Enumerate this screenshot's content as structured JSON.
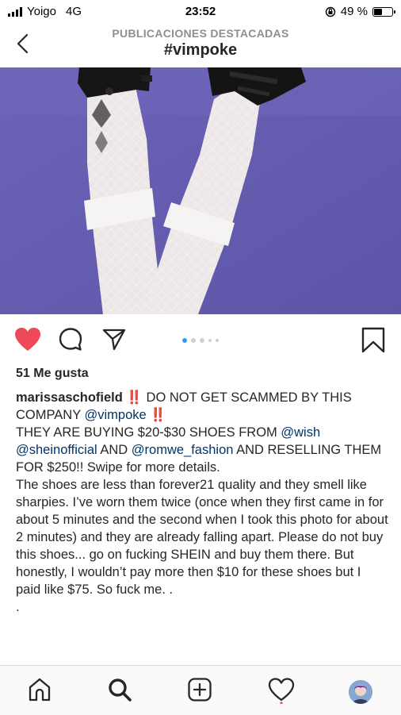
{
  "status_bar": {
    "carrier": "Yoigo",
    "network": "4G",
    "time": "23:52",
    "battery_percent": "49 %",
    "battery_level": 0.49
  },
  "header": {
    "subtitle": "PUBLICACIONES DESTACADAS",
    "title": "#vimpoke"
  },
  "post": {
    "photo_icon": "photo",
    "likes": "51 Me gusta",
    "carousel": {
      "count": 5,
      "active_index": 0
    },
    "caption": {
      "username": "marissaschofield",
      "bang": "‼️",
      "line1_text": " DO NOT GET SCAMMED BY THIS COMPANY ",
      "mention_vimpoke": "@vimpoke",
      "p2_a": "THEY ARE BUYING $20-$30 SHOES FROM ",
      "mention_wish": "@wish",
      "mention_shein": "@sheinofficial",
      "p2_and": " AND ",
      "mention_romwe": "@romwe_fashion",
      "p2_b": " AND RESELLING THEM FOR $250!! Swipe for more details.",
      "p3": "The shoes are less than forever21 quality and they smell like sharpies. I’ve worn them twice (once when they first came in for about 5 minutes and the second when I took this photo for about 2 minutes) and they are already falling apart. Please do not buy this shoes... go on fucking SHEIN and buy them there. But honestly, I wouldn’t pay more then $10 for these shoes but I paid like $75. So fuck me. .",
      "p4": "."
    }
  },
  "colors": {
    "accent_like": "#ed4956",
    "mention": "#003569",
    "dot_active": "#3897f0"
  },
  "icons": [
    "back-chevron-icon",
    "heart-icon",
    "comment-icon",
    "share-icon",
    "bookmark-icon",
    "home-icon",
    "search-icon",
    "add-icon",
    "activity-heart-icon"
  ]
}
